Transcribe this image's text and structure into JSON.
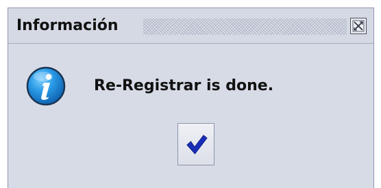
{
  "dialog": {
    "title": "Información",
    "message": "Re-Registrar is done.",
    "close_icon": "close-icon",
    "info_icon": "info-icon",
    "ok_icon": "checkmark-icon"
  },
  "colors": {
    "background": "#d7dbe6",
    "border": "#8c95ad",
    "info_blue": "#1f86d6",
    "checkmark": "#1a2fb8"
  }
}
